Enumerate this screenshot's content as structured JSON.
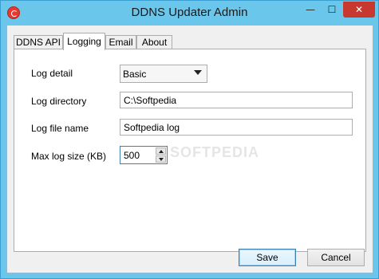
{
  "window": {
    "title": "DDNS Updater Admin",
    "controls": {
      "minimize": "—",
      "maximize": "☐",
      "close": "✕"
    }
  },
  "tabs": [
    {
      "label": "DDNS API",
      "active": false
    },
    {
      "label": "Logging",
      "active": true
    },
    {
      "label": "Email",
      "active": false
    },
    {
      "label": "About",
      "active": false
    }
  ],
  "logging": {
    "log_detail": {
      "label": "Log detail",
      "value": "Basic"
    },
    "log_directory": {
      "label": "Log directory",
      "value": "C:\\Softpedia"
    },
    "log_file_name": {
      "label": "Log file name",
      "value": "Softpedia log"
    },
    "max_log_size": {
      "label": "Max log size (KB)",
      "value": "500"
    }
  },
  "watermark": "SOFTPEDIA",
  "buttons": {
    "save": "Save",
    "cancel": "Cancel"
  },
  "colors": {
    "title_bar": "#6bc6eb",
    "close_button": "#c7392f",
    "app_icon": "#e8382f"
  }
}
